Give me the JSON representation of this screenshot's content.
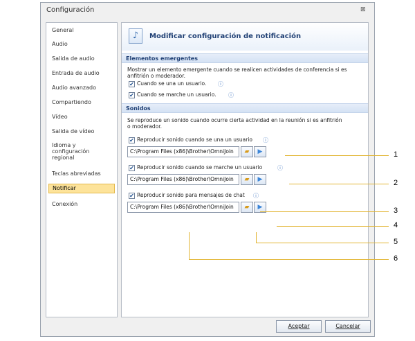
{
  "window": {
    "title": "Configuración",
    "close_glyph": "⊠"
  },
  "sidebar": {
    "items": [
      {
        "label": "General"
      },
      {
        "label": "Audio"
      },
      {
        "label": "Salida de audio"
      },
      {
        "label": "Entrada de audio"
      },
      {
        "label": "Audio avanzado"
      },
      {
        "label": "Compartiendo"
      },
      {
        "label": "Vídeo"
      },
      {
        "label": "Salida de vídeo"
      },
      {
        "label": "Idioma y"
      },
      {
        "label": "configuración"
      },
      {
        "label": "regional"
      },
      {
        "label": "Teclas abreviadas"
      },
      {
        "label": "Notificar"
      },
      {
        "label": "Conexión"
      }
    ],
    "active_label": "Notificar"
  },
  "header": {
    "title": "Modificar configuración de notificación",
    "icon": "music-note-icon"
  },
  "popups": {
    "heading": "Elementos emergentes",
    "desc1": "Mostrar un elemento emergente cuando se realicen actividades de conferencia si es",
    "desc2": "anfitrión o moderador.",
    "opt_join": "Cuando se una un usuario.",
    "opt_leave": "Cuando se marche un usuario."
  },
  "sounds": {
    "heading": "Sonidos",
    "desc1": "Se reproduce un sonido cuando ocurre cierta actividad en la reunión si es anfitrión",
    "desc2": "o moderador.",
    "opt_join": "Reproducir sonido cuando se una un usuario",
    "opt_leave": "Reproducir sonido cuando se marche un usuario",
    "opt_chat": "Reproducir sonido para mensajes de chat",
    "path_join": "C:\\Program Files (x86)\\Brother\\OmniJoin",
    "path_leave": "C:\\Program Files (x86)\\Brother\\OmniJoin",
    "path_chat": "C:\\Program Files (x86)\\Brother\\OmniJoin"
  },
  "footer": {
    "accept": "Aceptar",
    "cancel": "Cancelar"
  },
  "callouts": [
    "1",
    "2",
    "3",
    "4",
    "5",
    "6"
  ],
  "colors": {
    "active_item": "#fde39a",
    "callout_line": "#e2b533",
    "heading_text": "#1f3f74"
  },
  "glyphs": {
    "checked": "✔",
    "info": "ⓘ",
    "folder": "📂",
    "play": "▶"
  }
}
